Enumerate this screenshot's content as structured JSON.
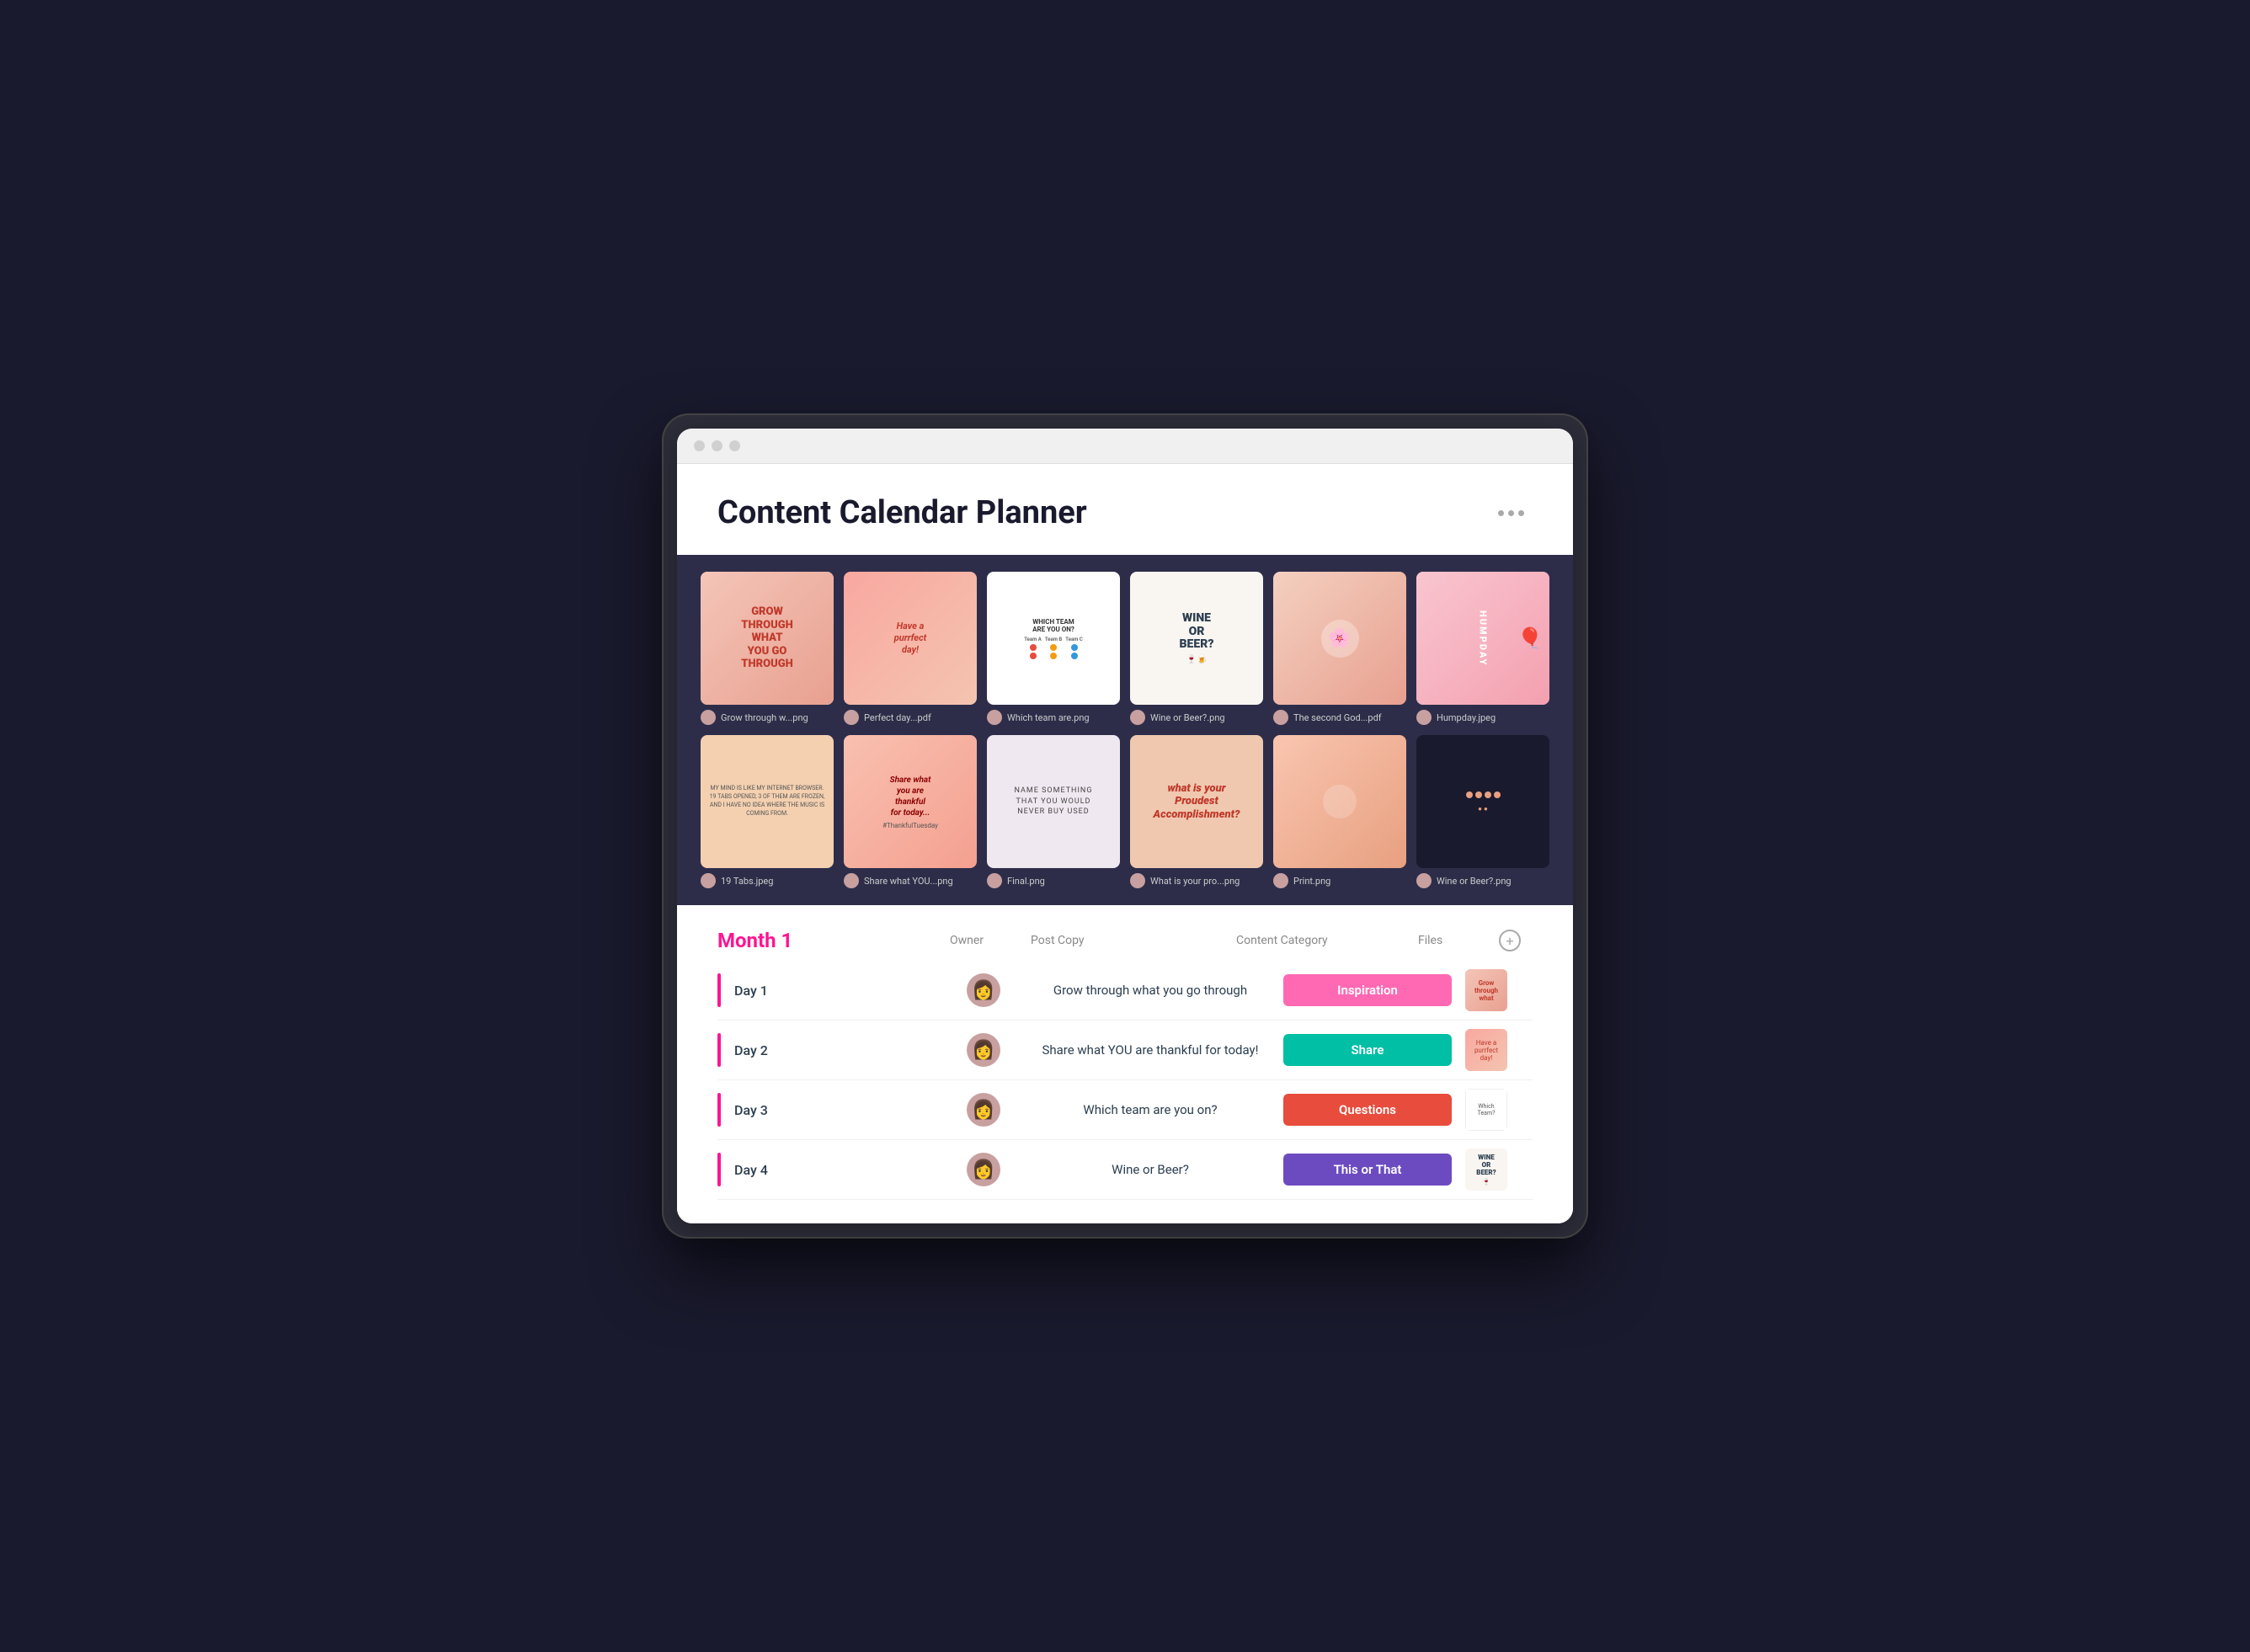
{
  "app": {
    "title": "Content Calendar Planner",
    "more_label": "..."
  },
  "gallery": {
    "row1": [
      {
        "filename": "Grow through w...png",
        "thumb_type": "grow"
      },
      {
        "filename": "Perfect day...pdf",
        "thumb_type": "purrfect"
      },
      {
        "filename": "Which team are.png",
        "thumb_type": "teams"
      },
      {
        "filename": "Wine or Beer?.png",
        "thumb_type": "wine"
      },
      {
        "filename": "The second God...pdf",
        "thumb_type": "flower"
      },
      {
        "filename": "Humpday.jpeg",
        "thumb_type": "humpday"
      }
    ],
    "row2": [
      {
        "filename": "19 Tabs.jpeg",
        "thumb_type": "tabs"
      },
      {
        "filename": "Share what YOU...png",
        "thumb_type": "thankful"
      },
      {
        "filename": "Final.png",
        "thumb_type": "name"
      },
      {
        "filename": "What is your pro...png",
        "thumb_type": "proudest"
      },
      {
        "filename": "Print.png",
        "thumb_type": "print"
      },
      {
        "filename": "Wine or Beer?.png",
        "thumb_type": "wineor2"
      }
    ]
  },
  "table": {
    "month_label": "Month 1",
    "columns": {
      "owner": "Owner",
      "post_copy": "Post Copy",
      "content_category": "Content Category",
      "files": "Files"
    },
    "rows": [
      {
        "day": "Day 1",
        "post_copy": "Grow through what you go through",
        "category": "Inspiration",
        "category_class": "badge-inspiration",
        "thumb_type": "ft-grow"
      },
      {
        "day": "Day 2",
        "post_copy": "Share what YOU are thankful for today!",
        "category": "Share",
        "category_class": "badge-share",
        "thumb_type": "ft-purrfect"
      },
      {
        "day": "Day 3",
        "post_copy": "Which team are you on?",
        "category": "Questions",
        "category_class": "badge-questions",
        "thumb_type": "ft-teams"
      },
      {
        "day": "Day 4",
        "post_copy": "Wine or Beer?",
        "category": "This or That",
        "category_class": "badge-this-or-that",
        "thumb_type": "ft-wine"
      }
    ],
    "add_button_label": "+"
  }
}
